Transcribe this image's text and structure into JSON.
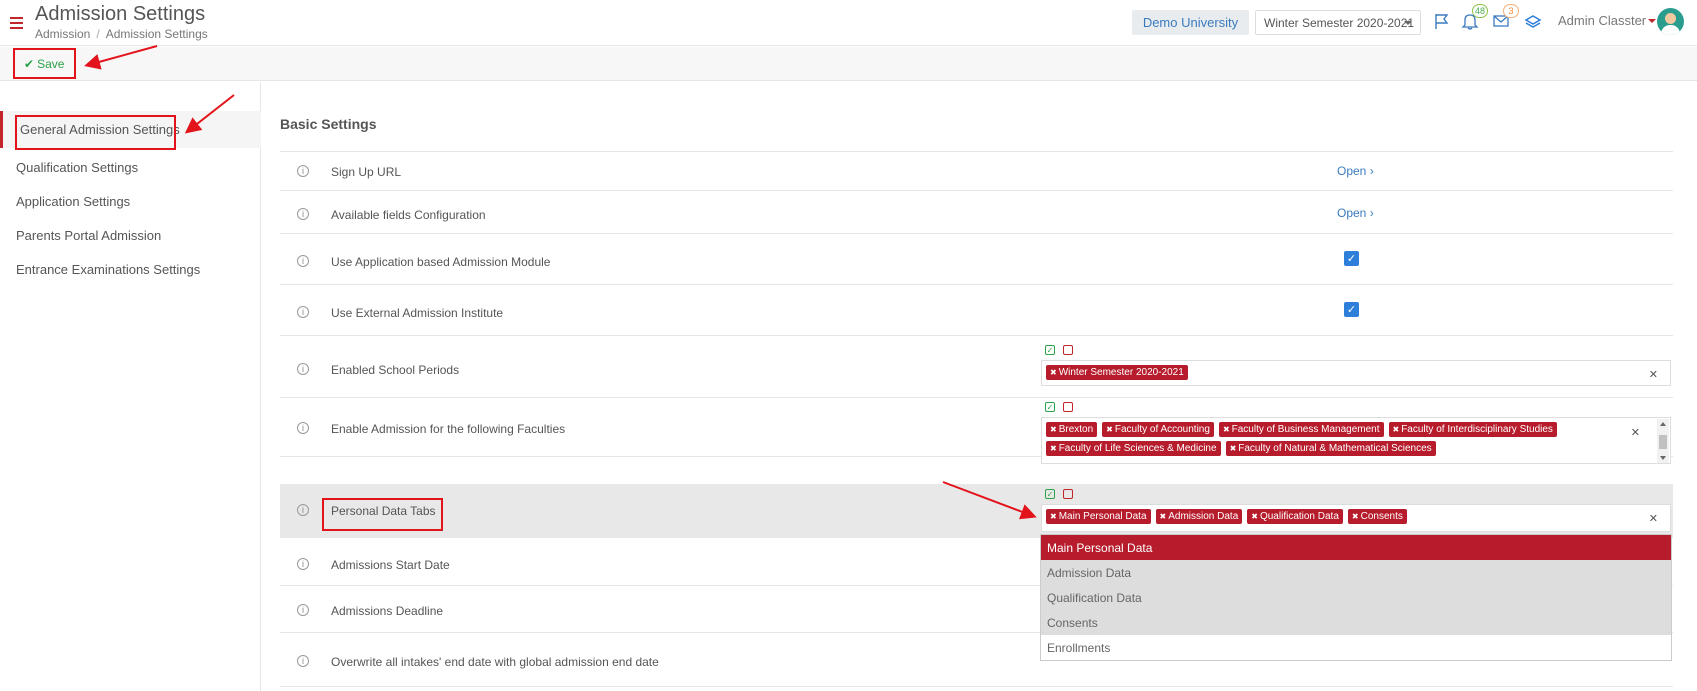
{
  "header": {
    "title": "Admission Settings",
    "breadcrumb": [
      "Admission",
      "Admission Settings"
    ],
    "breadcrumb_sep": "/",
    "university": "Demo University",
    "semester": "Winter Semester 2020-2021",
    "notifications_count": "48",
    "messages_count": "3",
    "user_name": "Admin Classter"
  },
  "toolbar": {
    "save_label": "Save"
  },
  "sidebar": {
    "items": [
      {
        "label": "General Admission Settings"
      },
      {
        "label": "Qualification Settings"
      },
      {
        "label": "Application Settings"
      },
      {
        "label": "Parents Portal Admission"
      },
      {
        "label": "Entrance Examinations Settings"
      }
    ]
  },
  "main": {
    "section_title": "Basic Settings",
    "open_label": "Open",
    "rows": [
      {
        "label": "Sign Up URL"
      },
      {
        "label": "Available fields Configuration"
      },
      {
        "label": "Use Application based Admission Module",
        "checked": true
      },
      {
        "label": "Use External Admission Institute",
        "checked": true
      },
      {
        "label": "Enabled School Periods",
        "tags": [
          "Winter Semester 2020-2021"
        ]
      },
      {
        "label": "Enable Admission for the following Faculties",
        "tags": [
          "Brexton",
          "Faculty of Accounting",
          "Faculty of Business Management",
          "Faculty of Interdisciplinary Studies",
          "Faculty of Life Sciences & Medicine",
          "Faculty of Natural & Mathematical Sciences"
        ]
      },
      {
        "label": "Personal Data Tabs",
        "tags": [
          "Main Personal Data",
          "Admission Data",
          "Qualification Data",
          "Consents"
        ]
      },
      {
        "label": "Admissions Start Date"
      },
      {
        "label": "Admissions Deadline"
      },
      {
        "label": "Overwrite all intakes' end date with global admission end date"
      }
    ],
    "dropdown_options": [
      "Main Personal Data",
      "Admission Data",
      "Qualification Data",
      "Consents",
      "Enrollments"
    ]
  },
  "colors": {
    "accent": "#b71c2c",
    "link": "#3a7bbf",
    "success": "#2ba34a",
    "annotation": "#e2131a"
  }
}
